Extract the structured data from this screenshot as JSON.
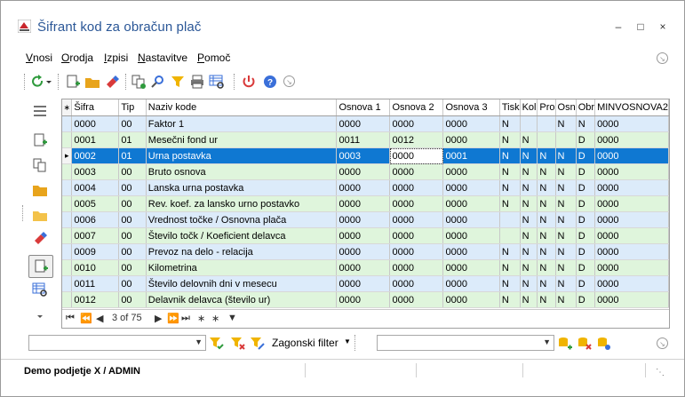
{
  "window": {
    "title": "Šifrant kod za obračun plač",
    "controls": [
      "?",
      "□",
      "×"
    ]
  },
  "menu": {
    "items": [
      {
        "label": "Vnosi",
        "underline": "V"
      },
      {
        "label": "Orodja",
        "underline": "O"
      },
      {
        "label": "Izpisi",
        "underline": "I"
      },
      {
        "label": "Nastavitve",
        "underline": "N"
      },
      {
        "label": "Pomoč",
        "underline": "P"
      }
    ]
  },
  "toolbar": {
    "icons": [
      "refresh-icon",
      "dropdown-arrow-icon",
      "new-record-icon",
      "open-folder-icon",
      "eraser-icon",
      "copy-icon",
      "search-icon",
      "filter-icon",
      "print-icon",
      "grid-settings-icon",
      "power-icon",
      "help-icon",
      "info-icon"
    ]
  },
  "sidebar": {
    "icons": [
      "hamburger-icon",
      "new-record-icon",
      "copy-icon",
      "folder-icon",
      "open-folder-icon",
      "eraser-icon",
      "new-record-icon",
      "grid-search-icon",
      "chevron-down-icon"
    ]
  },
  "grid": {
    "columns": [
      "Šifra",
      "Tip",
      "Naziv kode",
      "Osnova 1",
      "Osnova 2",
      "Osnova 3",
      "Tisk",
      "Kol",
      "Pro",
      "Osn",
      "Obr",
      "MINVOSNOVA2"
    ],
    "rows": [
      {
        "cells": [
          "0000",
          "00",
          "Faktor 1",
          "0000",
          "0000",
          "0000",
          "N",
          "",
          "",
          "N",
          "N",
          "0000"
        ],
        "style": "blue"
      },
      {
        "cells": [
          "0001",
          "01",
          "Mesečni fond ur",
          "0011",
          "0012",
          "0000",
          "N",
          "N",
          "",
          "",
          "D",
          "0000"
        ],
        "style": "green"
      },
      {
        "cells": [
          "0002",
          "01",
          "Urna postavka",
          "0003",
          "0000",
          "0001",
          "N",
          "N",
          "N",
          "N",
          "D",
          "0000"
        ],
        "style": "sel"
      },
      {
        "cells": [
          "0003",
          "00",
          "Bruto osnova",
          "0000",
          "0000",
          "0000",
          "N",
          "N",
          "N",
          "N",
          "D",
          "0000"
        ],
        "style": "green"
      },
      {
        "cells": [
          "0004",
          "00",
          "Lanska urna postavka",
          "0000",
          "0000",
          "0000",
          "N",
          "N",
          "N",
          "N",
          "D",
          "0000"
        ],
        "style": "blue"
      },
      {
        "cells": [
          "0005",
          "00",
          "Rev. koef. za lansko urno postavko",
          "0000",
          "0000",
          "0000",
          "N",
          "N",
          "N",
          "N",
          "D",
          "0000"
        ],
        "style": "green"
      },
      {
        "cells": [
          "0006",
          "00",
          "Vrednost točke / Osnovna plača",
          "0000",
          "0000",
          "0000",
          "",
          "N",
          "N",
          "N",
          "D",
          "0000"
        ],
        "style": "blue"
      },
      {
        "cells": [
          "0007",
          "00",
          "Število točk / Koeficient delavca",
          "0000",
          "0000",
          "0000",
          "",
          "N",
          "N",
          "N",
          "D",
          "0000"
        ],
        "style": "green"
      },
      {
        "cells": [
          "0009",
          "00",
          "Prevoz na delo - relacija",
          "0000",
          "0000",
          "0000",
          "N",
          "N",
          "N",
          "N",
          "D",
          "0000"
        ],
        "style": "blue"
      },
      {
        "cells": [
          "0010",
          "00",
          "Kilometrina",
          "0000",
          "0000",
          "0000",
          "N",
          "N",
          "N",
          "N",
          "D",
          "0000"
        ],
        "style": "green"
      },
      {
        "cells": [
          "0011",
          "00",
          "Število delovnih dni v mesecu",
          "0000",
          "0000",
          "0000",
          "N",
          "N",
          "N",
          "N",
          "D",
          "0000"
        ],
        "style": "blue"
      },
      {
        "cells": [
          "0012",
          "00",
          "Delavnik delavca (število ur)",
          "0000",
          "0000",
          "0000",
          "N",
          "N",
          "N",
          "N",
          "D",
          "0000"
        ],
        "style": "green"
      }
    ],
    "navigator": {
      "record_text": "3 of 75"
    }
  },
  "filter": {
    "filter_label": "Zagonski filter"
  },
  "status": {
    "text": "Demo podjetje X / ADMIN"
  },
  "colors": {
    "title": "#2b5797",
    "row_blue": "#dcebfa",
    "row_green": "#dff5dc",
    "selected": "#0f78d2"
  }
}
